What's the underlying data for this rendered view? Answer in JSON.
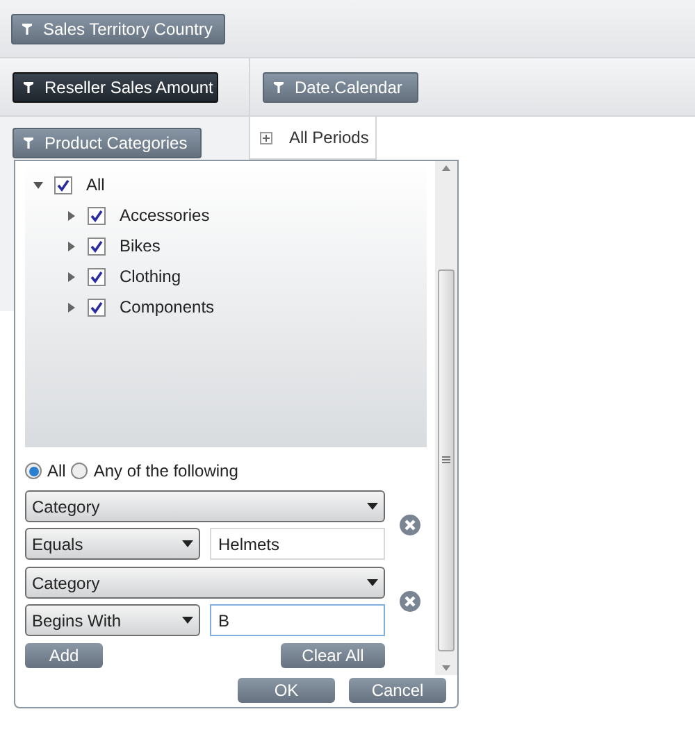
{
  "pivot": {
    "column_field": {
      "label": "Sales Territory Country"
    },
    "measure_field": {
      "label": "Reseller Sales Amount"
    },
    "row_field": {
      "label": "Date.Calendar"
    },
    "filter_field": {
      "label": "Product Categories"
    },
    "row_header": {
      "label": "All Periods",
      "expanded": false
    }
  },
  "filter_popup": {
    "tree": [
      {
        "label": "All",
        "checked": true,
        "expanded": true,
        "children": [
          {
            "label": "Accessories",
            "checked": true,
            "expanded": false
          },
          {
            "label": "Bikes",
            "checked": true,
            "expanded": false
          },
          {
            "label": "Clothing",
            "checked": true,
            "expanded": false
          },
          {
            "label": "Components",
            "checked": true,
            "expanded": false
          }
        ]
      }
    ],
    "match_mode": [
      {
        "label": "All",
        "selected": true
      },
      {
        "label": "Any of the following",
        "selected": false
      }
    ],
    "conditions": [
      {
        "field": "Category",
        "operator": "Equals",
        "value": "Helmets",
        "focused": false
      },
      {
        "field": "Category",
        "operator": "Begins With",
        "value": "B",
        "focused": true
      }
    ],
    "add_button": "Add",
    "clear_button": "Clear All",
    "ok_button": "OK",
    "cancel_button": "Cancel"
  }
}
